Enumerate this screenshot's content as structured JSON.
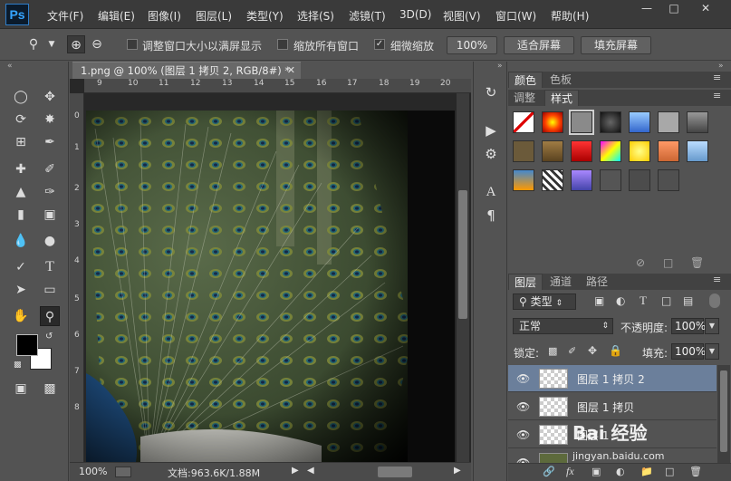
{
  "app": {
    "logo": "Ps"
  },
  "menu": [
    "文件(F)",
    "编辑(E)",
    "图像(I)",
    "图层(L)",
    "类型(Y)",
    "选择(S)",
    "滤镜(T)",
    "3D(D)",
    "视图(V)",
    "窗口(W)",
    "帮助(H)"
  ],
  "options": {
    "resize_windows": "调整窗口大小以满屏显示",
    "zoom_all": "缩放所有窗口",
    "scrubby_zoom": "细微缩放",
    "zoom_value": "100%",
    "fit_screen": "适合屏幕",
    "fill_screen": "填充屏幕"
  },
  "document": {
    "tab_title": "1.png @ 100% (图层 1 拷贝 2, RGB/8#) *",
    "ruler_top": [
      "9",
      "10",
      "11",
      "12",
      "13",
      "14",
      "15",
      "16",
      "17",
      "18",
      "19",
      "20"
    ],
    "ruler_left": [
      "0",
      "1",
      "2",
      "3",
      "4",
      "5",
      "6",
      "7",
      "8"
    ]
  },
  "status": {
    "zoom": "100%",
    "doc_size": "文档:963.6K/1.88M"
  },
  "panels": {
    "top_tabs": [
      "颜色",
      "色板"
    ],
    "style_tabs": [
      "调整",
      "样式"
    ],
    "layer_tabs": [
      "图层",
      "通道",
      "路径"
    ],
    "filter_kind": "类型",
    "blend_mode": "正常",
    "opacity_label": "不透明度:",
    "opacity_value": "100%",
    "lock_label": "锁定:",
    "fill_label": "填充:",
    "fill_value": "100%"
  },
  "layers": [
    {
      "name": "图层 1 拷贝 2",
      "selected": true
    },
    {
      "name": "图层 1 拷贝",
      "selected": false
    },
    {
      "name": "图层 1",
      "selected": false
    },
    {
      "name": "",
      "selected": false
    }
  ],
  "watermark": {
    "brand": "Bai 经验",
    "url": "jingyan.baidu.com"
  },
  "colors": {
    "accent_ps": "#35a4ff",
    "selected_layer": "#6b7f9b",
    "foreground": "#000000",
    "background": "#ffffff"
  }
}
